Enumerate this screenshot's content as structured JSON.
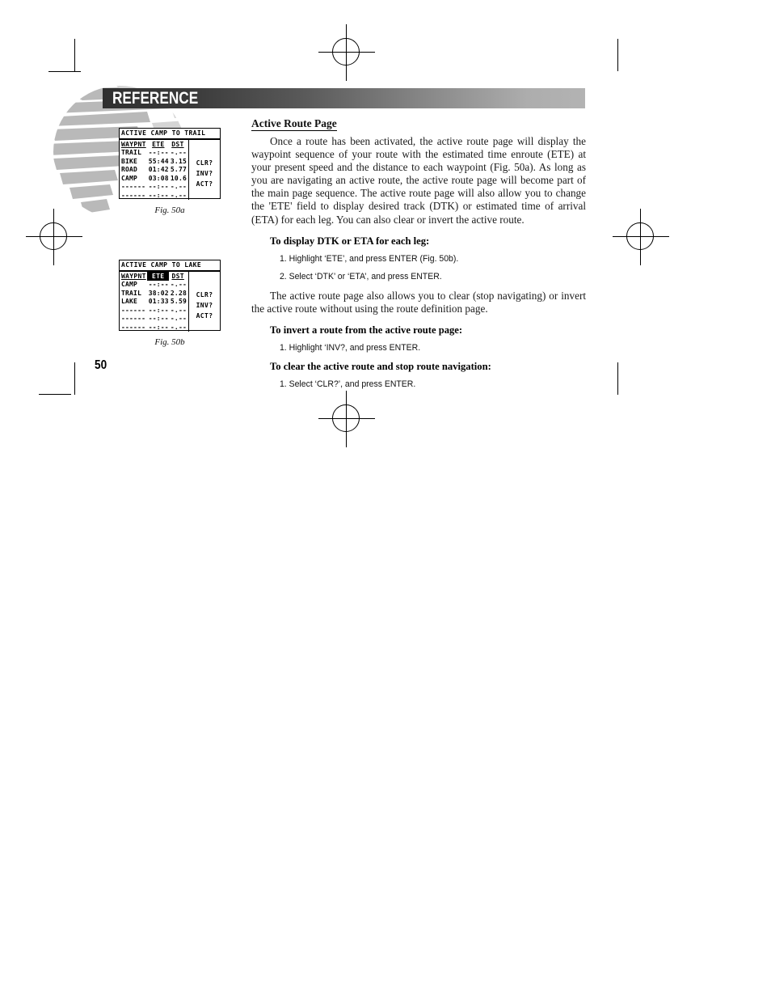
{
  "header": {
    "banner_title": "REFERENCE"
  },
  "page_number": "50",
  "figures": [
    {
      "caption": "Fig. 50a",
      "screen": {
        "title": "ACTIVE  CAMP TO TRAIL",
        "columns": [
          "WAYPNT",
          "ETE",
          "DST"
        ],
        "highlighted_column": "",
        "rows": [
          {
            "waypoint": "TRAIL",
            "ete": "--:--",
            "dst": "-.--"
          },
          {
            "waypoint": "BIKE",
            "ete": "55:44",
            "dst": "3.15"
          },
          {
            "waypoint": "ROAD",
            "ete": "01:42",
            "dst": "5.77"
          },
          {
            "waypoint": "CAMP",
            "ete": "03:08",
            "dst": "10.6"
          },
          {
            "waypoint": "------",
            "ete": "--:--",
            "dst": "-.--"
          },
          {
            "waypoint": "------",
            "ete": "--:--",
            "dst": "-.--"
          }
        ],
        "buttons": [
          "CLR?",
          "INV?",
          "ACT?"
        ]
      }
    },
    {
      "caption": "Fig. 50b",
      "screen": {
        "title": "ACTIVE  CAMP TO LAKE",
        "columns": [
          "WAYPNT",
          "ETE",
          "DST"
        ],
        "highlighted_column": "ETE",
        "rows": [
          {
            "waypoint": "CAMP",
            "ete": "--:--",
            "dst": "-.--"
          },
          {
            "waypoint": "TRAIL",
            "ete": "38:02",
            "dst": "2.28"
          },
          {
            "waypoint": "LAKE",
            "ete": "01:33",
            "dst": "5.59"
          },
          {
            "waypoint": "------",
            "ete": "--:--",
            "dst": "-.--"
          },
          {
            "waypoint": "------",
            "ete": "--:--",
            "dst": "-.--"
          },
          {
            "waypoint": "------",
            "ete": "--:--",
            "dst": "-.--"
          }
        ],
        "buttons": [
          "CLR?",
          "INV?",
          "ACT?"
        ]
      }
    }
  ],
  "content": {
    "section_title": "Active Route Page",
    "intro_paragraph": "Once a route has been activated, the active route page will display the waypoint sequence of your route with the estimated time enroute (ETE) at your present speed and the distance to each waypoint (Fig. 50a). As long as you are navigating an active route, the active route page will become part of the main page sequence. The active route page will also allow you to change the 'ETE' field to display desired track (DTK) or estimated time of arrival (ETA) for each leg. You can also clear or invert the active route.",
    "proc1_heading": "To display DTK or ETA for each leg:",
    "proc1_step1": "1. Highlight ‘ETE’, and press ENTER (Fig. 50b).",
    "proc1_step2": "2. Select ‘DTK’ or ‘ETA’, and press ENTER.",
    "middle_paragraph": "The active route page also allows you to clear (stop navigating) or invert the active route without using the route definition page.",
    "proc2_heading": "To invert a route from the active route page:",
    "proc2_step1": "1. Highlight ‘INV?, and press ENTER.",
    "proc3_heading": "To clear the active route and stop route navigation:",
    "proc3_step1": "1. Select ‘CLR?’, and press ENTER."
  }
}
